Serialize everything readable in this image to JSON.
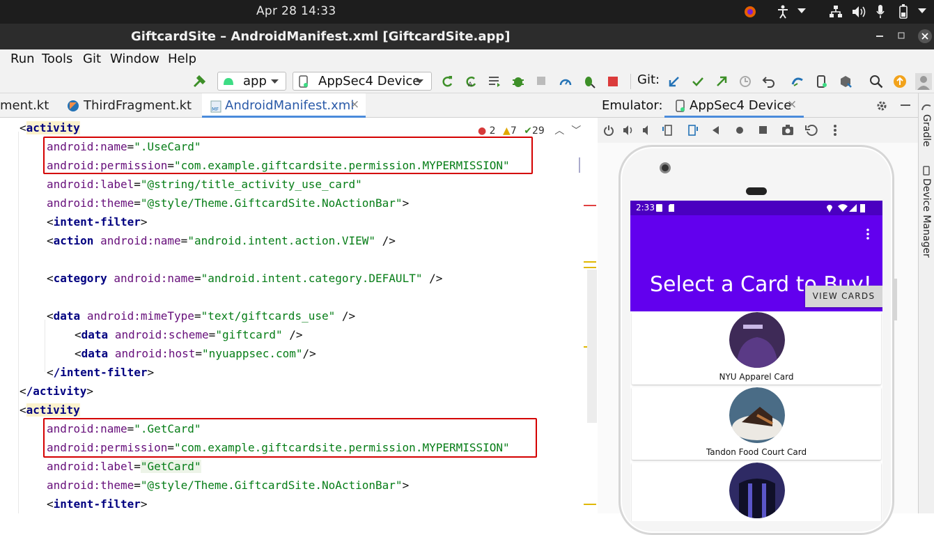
{
  "topbar": {
    "clock": "Apr 28  14:33"
  },
  "window": {
    "title": "GiftcardSite – AndroidManifest.xml [GiftcardSite.app]"
  },
  "menu": {
    "run": "Run",
    "tools": "Tools",
    "git": "Git",
    "window": "Window",
    "help": "Help"
  },
  "toolbar": {
    "config": "app",
    "device": "AppSec4 Device",
    "git_label": "Git:"
  },
  "tabs": [
    {
      "label": "ment.kt"
    },
    {
      "label": "ThirdFragment.kt"
    },
    {
      "label": "AndroidManifest.xml",
      "close": "×"
    }
  ],
  "inspections": {
    "errors": "2",
    "warnings": "7",
    "ok": "29"
  },
  "code": {
    "l1_tag": "activity",
    "l2_attr": "android:name",
    "l2_val": "\".UseCard\"",
    "l3_attr": "android:permission",
    "l3_val": "\"com.example.giftcardsite.permission.MYPERMISSION\"",
    "l4_attr": "android:label",
    "l4_val": "\"@string/title_activity_use_card\"",
    "l5_attr": "android:theme",
    "l5_val": "\"@style/Theme.GiftcardSite.NoActionBar\"",
    "l6_tag": "intent-filter",
    "l7_tag": "action",
    "l7_attr": "android:name",
    "l7_val": "\"android.intent.action.VIEW\"",
    "l9_tag": "category",
    "l9_attr": "android:name",
    "l9_val": "\"android.intent.category.DEFAULT\"",
    "l11_tag": "data",
    "l11_attr": "android:mimeType",
    "l11_val": "\"text/giftcards_use\"",
    "l12_tag": "data",
    "l12_attr": "android:scheme",
    "l12_val": "\"giftcard\"",
    "l13_tag": "data",
    "l13_attr": "android:host",
    "l13_val": "\"nyuappsec.com\"",
    "l14_tag": "/intent-filter",
    "l15_tag": "/activity",
    "l16_tag": "activity",
    "l17_attr": "android:name",
    "l17_val": "\".GetCard\"",
    "l18_attr": "android:permission",
    "l18_val": "\"com.example.giftcardsite.permission.MYPERMISSION\"",
    "l19_attr": "android:label",
    "l19_val": "\"GetCard\"",
    "l20_attr": "android:theme",
    "l20_val": "\"@style/Theme.GiftcardSite.NoActionBar\"",
    "l21_tag": "intent-filter"
  },
  "emulator": {
    "label": "Emulator:",
    "tab": "AppSec4 Device",
    "close": "×"
  },
  "side": {
    "gradle": "Gradle",
    "device_manager": "Device Manager"
  },
  "phone": {
    "time": "2:33",
    "title": "Select a Card to Buy!",
    "view_cards": "VIEW CARDS",
    "cards": [
      {
        "label": "NYU Apparel Card"
      },
      {
        "label": "Tandon Food Court Card"
      }
    ]
  },
  "colors": {
    "accent": "#6200ee",
    "status": "#4a00c0",
    "highlight": "#d40000"
  }
}
